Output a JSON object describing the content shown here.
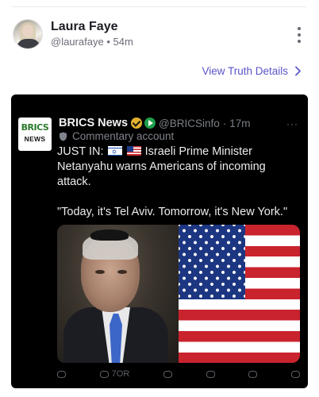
{
  "post": {
    "author_name": "Laura Faye",
    "author_handle": "@laurafaye",
    "separator": "•",
    "time_ago": "54m",
    "more_icon": "more-vertical-icon"
  },
  "truth_link": {
    "label": "View Truth Details",
    "icon": "chevron-right-icon",
    "color": "#5b55c9"
  },
  "embedded_tweet": {
    "logo_line1": "BRICS",
    "logo_line2": "NEWS",
    "name": "BRICS News",
    "handle": "@BRICSinfo",
    "dot": "·",
    "time": "17m",
    "more": "···",
    "commentary_label": "Commentary account",
    "text_prefix": "JUST IN:",
    "text_headline": "Israeli Prime Minister Netanyahu warns Americans of incoming attack.",
    "quote": "\"Today, it's Tel Aviv. Tomorrow, it's New York.\"",
    "retweet_count": "7OR",
    "colors": {
      "background": "#000000",
      "gold_badge": "#e2b12e",
      "green_badge": "#1e9e4a"
    }
  }
}
